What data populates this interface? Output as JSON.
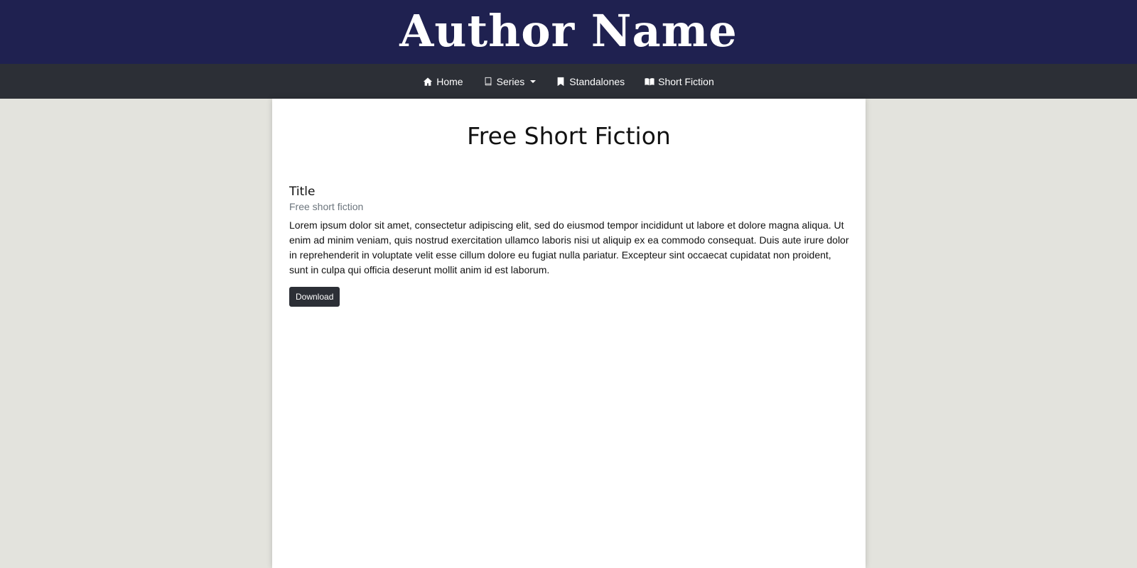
{
  "header": {
    "title": "Author Name",
    "background": "#1f2150"
  },
  "nav": {
    "background": "#2c2f36",
    "items": [
      {
        "label": "Home",
        "icon": "home-icon"
      },
      {
        "label": "Series",
        "icon": "book-icon",
        "dropdown": true
      },
      {
        "label": "Standalones",
        "icon": "bookmark-icon"
      },
      {
        "label": "Short Fiction",
        "icon": "open-book-icon"
      }
    ]
  },
  "main": {
    "heading": "Free Short Fiction",
    "stories": [
      {
        "title": "Title",
        "subtitle": "Free short fiction",
        "body": "Lorem ipsum dolor sit amet, consectetur adipiscing elit, sed do eiusmod tempor incididunt ut labore et dolore magna aliqua. Ut enim ad minim veniam, quis nostrud exercitation ullamco laboris nisi ut aliquip ex ea commodo consequat. Duis aute irure dolor in reprehenderit in voluptate velit esse cillum dolore eu fugiat nulla pariatur. Excepteur sint occaecat cupidatat non proident, sunt in culpa qui officia deserunt mollit anim id est laborum.",
        "button_label": "Download"
      }
    ]
  },
  "page_background": "#e3e3dd"
}
